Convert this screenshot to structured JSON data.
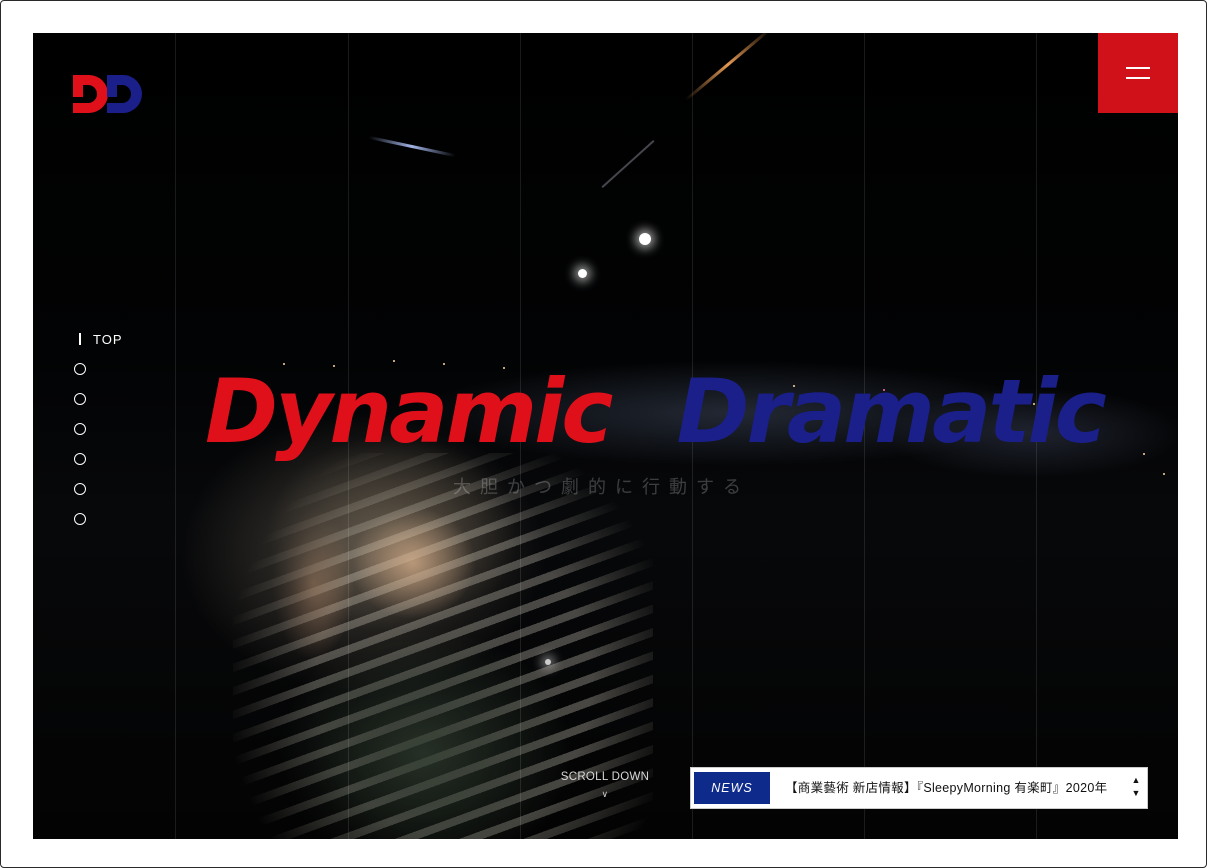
{
  "brand": {
    "logo_text": "DD",
    "colors": {
      "red": "#e0101b",
      "blue": "#1a1f8a",
      "menu_red": "#d0111a",
      "news_blue": "#0e2b8c"
    }
  },
  "header": {
    "menu_icon": "hamburger-icon"
  },
  "side_nav": {
    "active_label": "TOP",
    "dot_count": 6
  },
  "hero": {
    "headline_word_1": "Dynamic",
    "headline_word_2": "Dramatic",
    "subcopy": "大胆かつ劇的に行動する",
    "scroll_label": "SCROLL DOWN",
    "scroll_icon": "chevron-down-icon"
  },
  "news": {
    "label": "NEWS",
    "text": "【商業藝術 新店情報】『SleepyMorning 有楽町』2020年",
    "up_icon": "triangle-up-icon",
    "down_icon": "triangle-down-icon"
  }
}
